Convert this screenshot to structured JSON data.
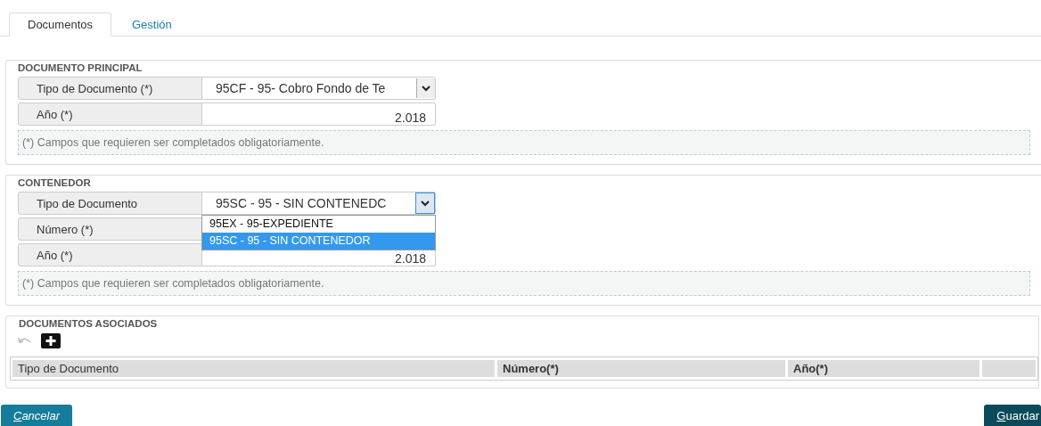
{
  "tabs": [
    {
      "label": "Documentos",
      "selected": true
    },
    {
      "label": "Gestión",
      "selected": false
    }
  ],
  "sections": [
    {
      "title": "DOCUMENTO PRINCIPAL",
      "fields": [
        {
          "kind": "select",
          "label": "Tipo de Documento (*)",
          "value": "95CF - 95- Cobro Fondo de Te",
          "open": false
        },
        {
          "kind": "text",
          "label": "Año (*)",
          "value": "2.018"
        }
      ],
      "note": "(*) Campos que requieren ser completados obligatoriamente."
    },
    {
      "title": "CONTENEDOR",
      "fields": [
        {
          "kind": "select",
          "label": "Tipo de Documento",
          "value": "95SC - 95 - SIN CONTENEDC",
          "open": true,
          "options": [
            {
              "label": "95EX - 95-EXPEDIENTE",
              "selected": false
            },
            {
              "label": "95SC - 95 - SIN CONTENEDOR",
              "selected": true
            }
          ]
        },
        {
          "kind": "text",
          "label": "Número (*)"
        },
        {
          "kind": "text",
          "label": "Año (*)",
          "value": "2.018"
        }
      ],
      "note": "(*) Campos que requieren ser completados obligatoriamente."
    }
  ],
  "associated": {
    "title": "DOCUMENTOS ASOCIADOS",
    "columns": [
      "Tipo de Documento",
      "Número(*)",
      "Año(*)"
    ]
  },
  "buttons": [
    {
      "kind": "secondary",
      "label": "Cancelar"
    },
    {
      "kind": "primary",
      "label": "Guardar"
    }
  ]
}
